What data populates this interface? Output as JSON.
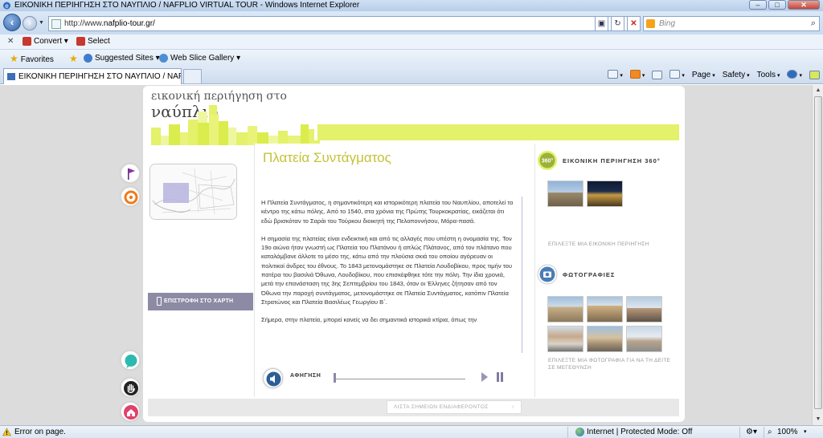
{
  "window": {
    "title": "ΕΙΚΟΝΙΚΗ ΠΕΡΙΗΓΗΣΗ ΣΤΟ ΝΑΥΠΛΙΟ / NAFPLIO VIRTUAL TOUR - Windows Internet Explorer",
    "min": "–",
    "max": "□",
    "close": "✕"
  },
  "address": {
    "url_prefix": "http://www.",
    "url_domain": "nafplio-tour.gr/",
    "search_placeholder": "Bing"
  },
  "commandbar": {
    "convert_label": "Convert",
    "select_label": "Select"
  },
  "favorites": {
    "favorites_label": "Favorites",
    "suggested_label": "Suggested Sites",
    "webslice_label": "Web Slice Gallery"
  },
  "tab": {
    "title": "ΕΙΚΟΝΙΚΗ ΠΕΡΙΗΓΗΣΗ ΣΤΟ ΝΑΥΠΛΙΟ / NAFPLIO..."
  },
  "ie_tools": {
    "page": "Page",
    "safety": "Safety",
    "tools": "Tools"
  },
  "site": {
    "logo_top": "εικονική περιήγηση στο",
    "logo_main": "ναύπλιο",
    "return_label": "ΕΠΙΣΤΡΟΦΗ ΣΤΟ ΧΑΡΤΗ",
    "page_title": "Πλατεία Συντάγματος",
    "paragraphs": [
      "Η Πλατεία Συντάγματος, η σημαντικότερη και ιστορικότερη πλατεία του Ναυπλίου, αποτελεί το κέντρο της κάτω πόλης. Από το 1540, στα χρόνια της Πρώτης Τουρκοκρατίας, εικάζεται ότι εδώ βρισκόταν το Σαράι του Τούρκου διοικητή της Πελοποννήσου, Μόρα-πασά.",
      "Η σημασία της πλατείας είναι ενδεικτική και από τις αλλαγές που υπέστη η ονομασία της. Τον 19ο αιώνα ήταν γνωστή ως Πλατεία του Πλατάνου ή απλώς Πλάτανος, από τον πλάτανο που καταλάμβανε άλλοτε το μέσο της, κάτω από την πλούσια σκιά του οποίου αγόρευαν οι πολιτικοί άνδρες του έθνους. Το 1843 μετονομάστηκε σε Πλατεία Λουδοβίκου, προς τιμήν του πατέρα του βασιλιά Όθωνα, Λουδοβίκου, που επισκέφθηκε τότε την πόλη. Την ίδια χρονιά, μετά την επανάσταση της 3ης Σεπτεμβρίου του 1843, όταν οι Έλληνες ζήτησαν από τον Όθωνα την παροχή συντάγματος, μετονομάστηκε σε Πλατεία Συντάγματος, κατόπιν Πλατεία Στρατώνος και Πλατεία Βασιλέως Γεωργίου Β΄.",
      "Σήμερα, στην πλατεία, μπορεί κανείς να δει σημαντικά ιστορικά κτίρια, όπως την"
    ],
    "audio_label": "ΑΦΗΓΗΣΗ",
    "audio_progress": 0,
    "tour_title": "ΕΙΚΟΝΙΚΗ ΠΕΡΙΗΓΗΣΗ 360°",
    "tour_badge": "360°",
    "tour_hint": "ΕΠΙΛΕΞΤΕ ΜΙΑ ΕΙΚΟΝΙΚΗ ΠΕΡΙΗΓΗΣΗ",
    "photos_title": "ΦΩΤΟΓΡΑΦΙΕΣ",
    "photos_hint": "ΕΠΙΛΕΞΤΕ ΜΙΑ ΦΩΤΟΓΡΑΦΙΑ ΓΙΑ ΝΑ ΤΗ ΔΕΙΤΕ ΣΕ ΜΕΓΕΘΥΝΣΗ",
    "poi_label": "ΛΙΣΤΑ ΣΗΜΕΙΩΝ ΕΝΔΙΑΦΕΡΟΝΤΟΣ",
    "poi_arrow": "↑",
    "accent_color": "#e4f16a",
    "title_color": "#c4c237"
  },
  "status": {
    "error_text": "Error on page.",
    "zone_text": "Internet | Protected Mode: Off",
    "zoom_text": "100%"
  }
}
